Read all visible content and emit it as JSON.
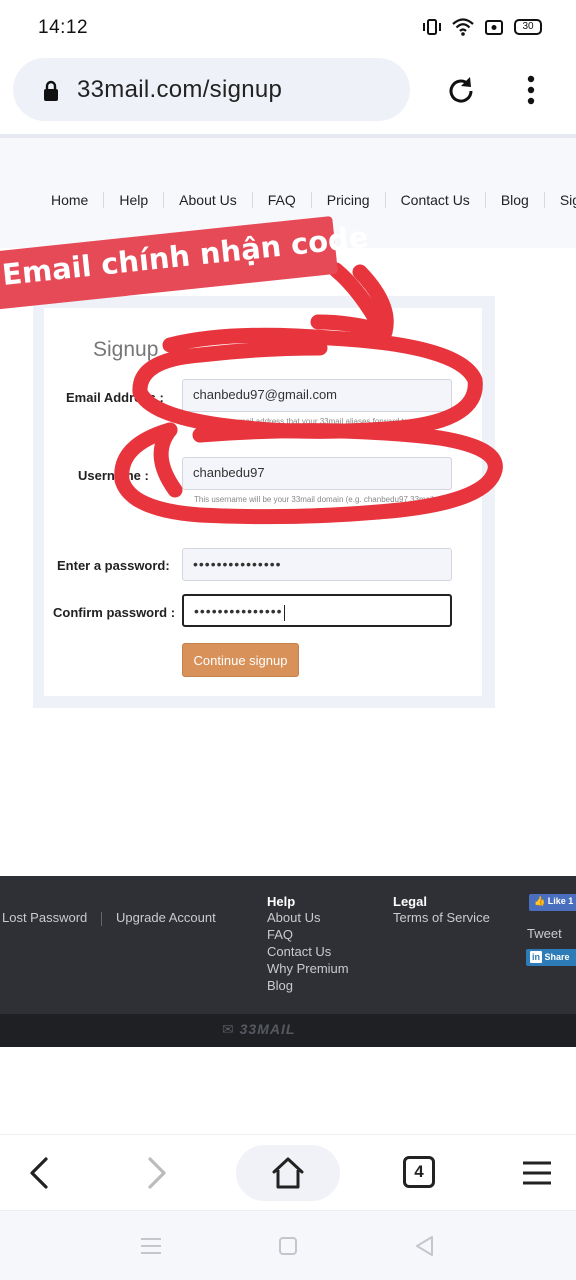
{
  "status_bar": {
    "time": "14:12",
    "battery": "30"
  },
  "browser": {
    "url": "33mail.com/signup",
    "tab_count": "4"
  },
  "nav": {
    "items": [
      "Home",
      "Help",
      "About Us",
      "FAQ",
      "Pricing",
      "Contact Us",
      "Blog",
      "Sign Up"
    ]
  },
  "annotation": {
    "banner": "Email chính nhận code"
  },
  "form": {
    "title": "Signup",
    "email_label": "Email Address :",
    "email_value": "chanbedu97@gmail.com",
    "email_hint": "the email address that your 33mail aliases forward to",
    "username_label": "Username :",
    "username_value": "chanbedu97",
    "username_hint": "This username will be your 33mail domain (e.g. chanbedu97.33mail.com)",
    "password_label": "Enter a password:",
    "password_value": "•••••••••••••••",
    "confirm_label": "Confirm password :",
    "confirm_value": "•••••••••••••••",
    "submit_label": "Continue signup"
  },
  "footer": {
    "account_links": [
      "Lost Password",
      "Upgrade Account"
    ],
    "help_heading": "Help",
    "help_links": [
      "About Us",
      "FAQ",
      "Contact Us",
      "Why Premium",
      "Blog"
    ],
    "legal_heading": "Legal",
    "legal_links": [
      "Terms of Service"
    ],
    "fb_like": "Like 1",
    "tweet": "Tweet",
    "linkedin_share": "Share",
    "logo": "33MAIL"
  },
  "colors": {
    "accent_button": "#d9915a",
    "annotation_red": "#e8343d",
    "footer_bg": "#2e3035"
  }
}
